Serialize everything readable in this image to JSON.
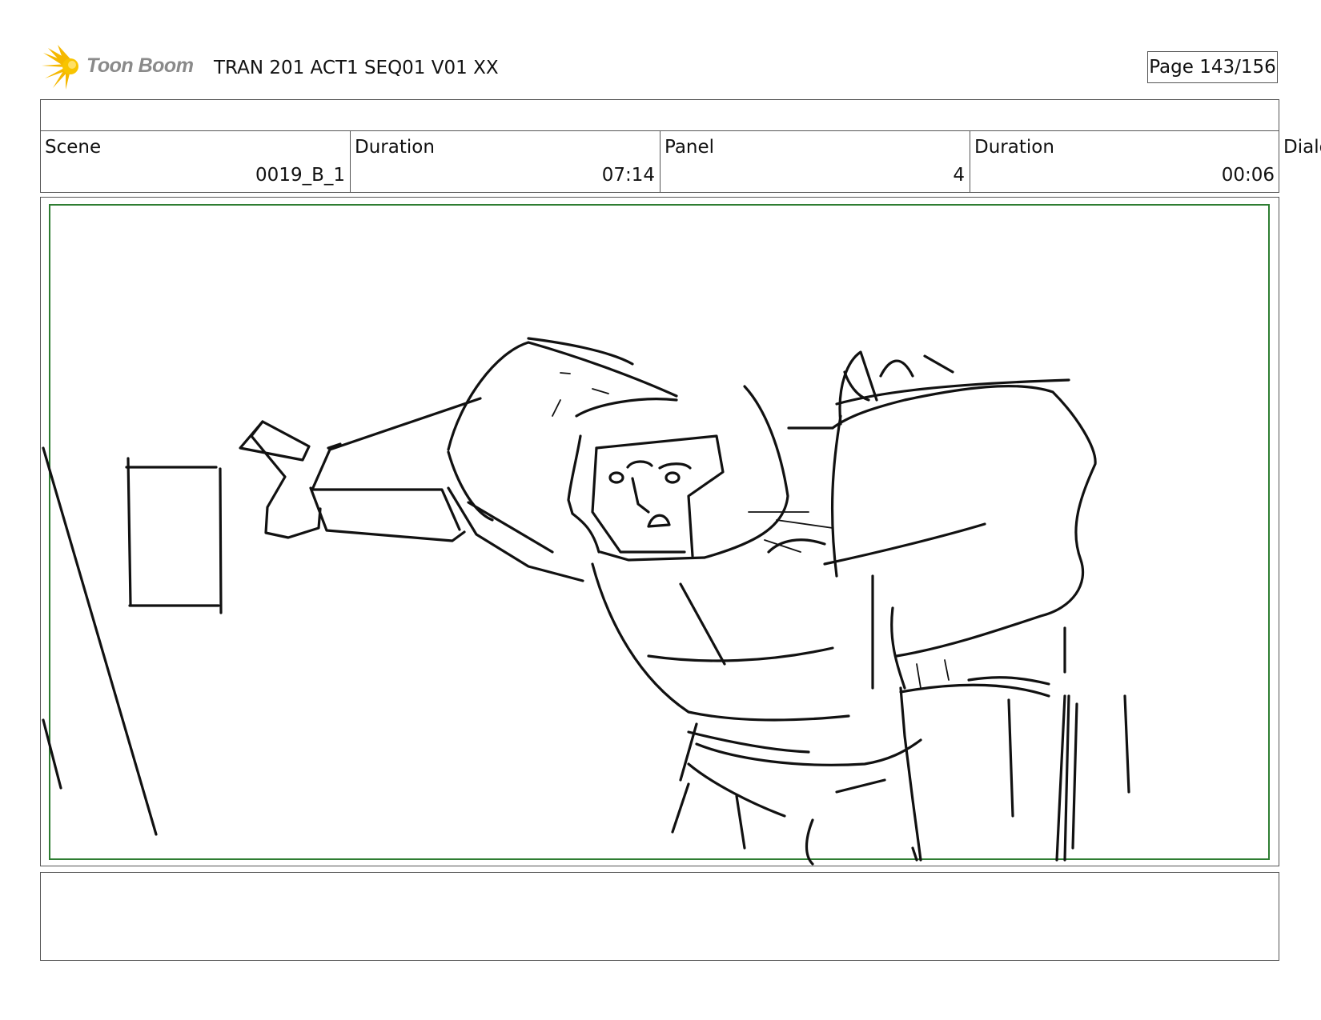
{
  "header": {
    "logo_text": "Toon Boom",
    "document_title": "TRAN 201 ACT1 SEQ01 V01 XX",
    "page_label": "Page 143/156"
  },
  "info": {
    "scene_label": "Scene",
    "scene_value": "0019_B_1",
    "scene_duration_label": "Duration",
    "scene_duration_value": "07:14",
    "panel_label": "Panel",
    "panel_value": "4",
    "panel_duration_label": "Duration",
    "panel_duration_value": "00:06",
    "dialogue_label": "Dialo"
  },
  "colors": {
    "panel_border": "#2e7d32",
    "logo_burst": "#f5b800",
    "logo_text": "#8a8a8a"
  }
}
